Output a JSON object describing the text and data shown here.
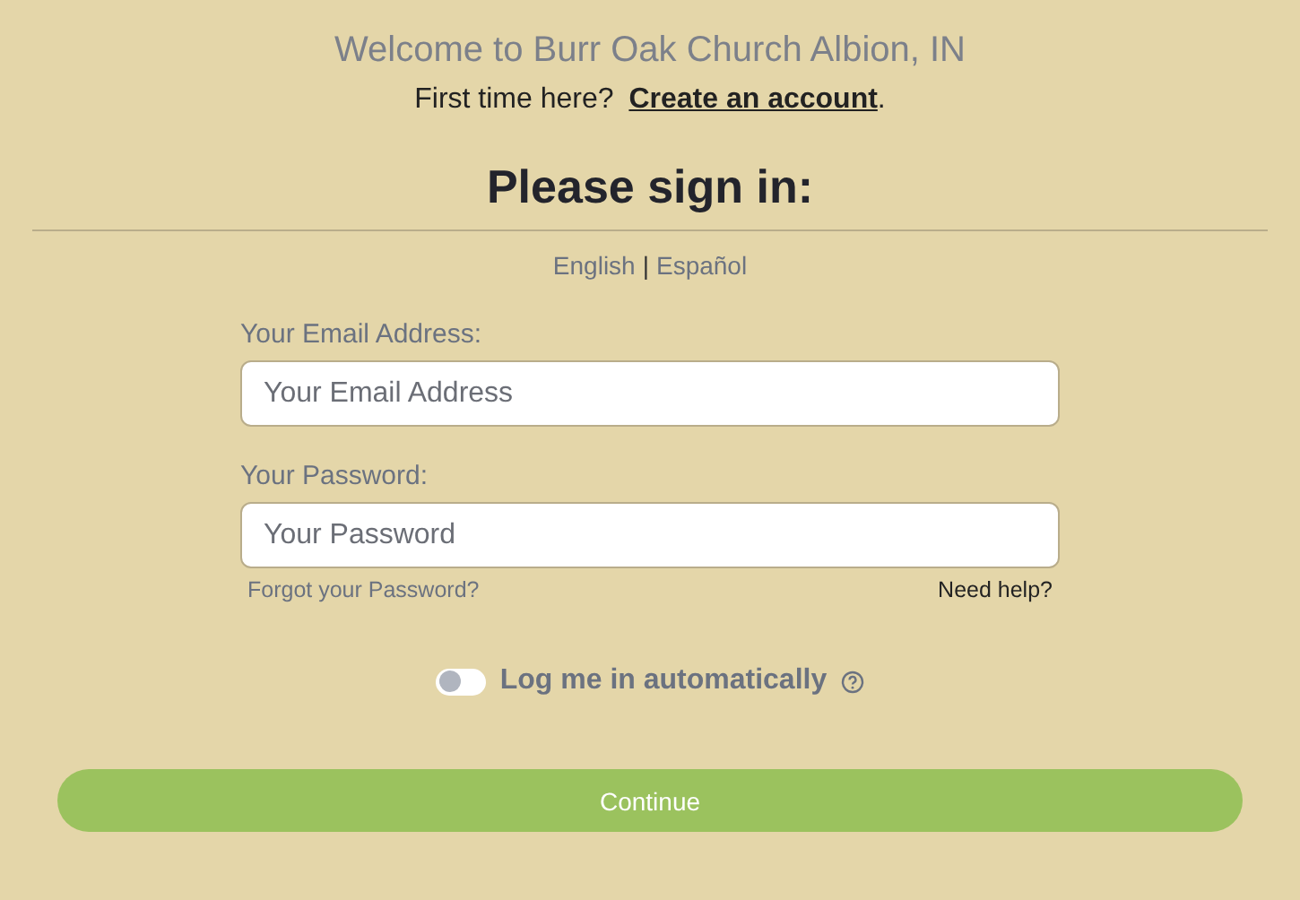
{
  "welcome": "Welcome to Burr Oak Church Albion, IN",
  "first_time": {
    "prefix": "First time here? ",
    "link": "Create an account",
    "suffix": "."
  },
  "heading": "Please sign in:",
  "languages": {
    "items": [
      "English",
      "Español"
    ],
    "separator": "|"
  },
  "fields": [
    {
      "label": "Your Email Address:",
      "placeholder": "Your Email Address"
    },
    {
      "label": "Your Password:",
      "placeholder": "Your Password"
    }
  ],
  "forgot_link": "Forgot your Password?",
  "help_link": "Need help?",
  "auto_login": {
    "label": "Log me in automatically",
    "on": false
  },
  "continue_button": "Continue"
}
